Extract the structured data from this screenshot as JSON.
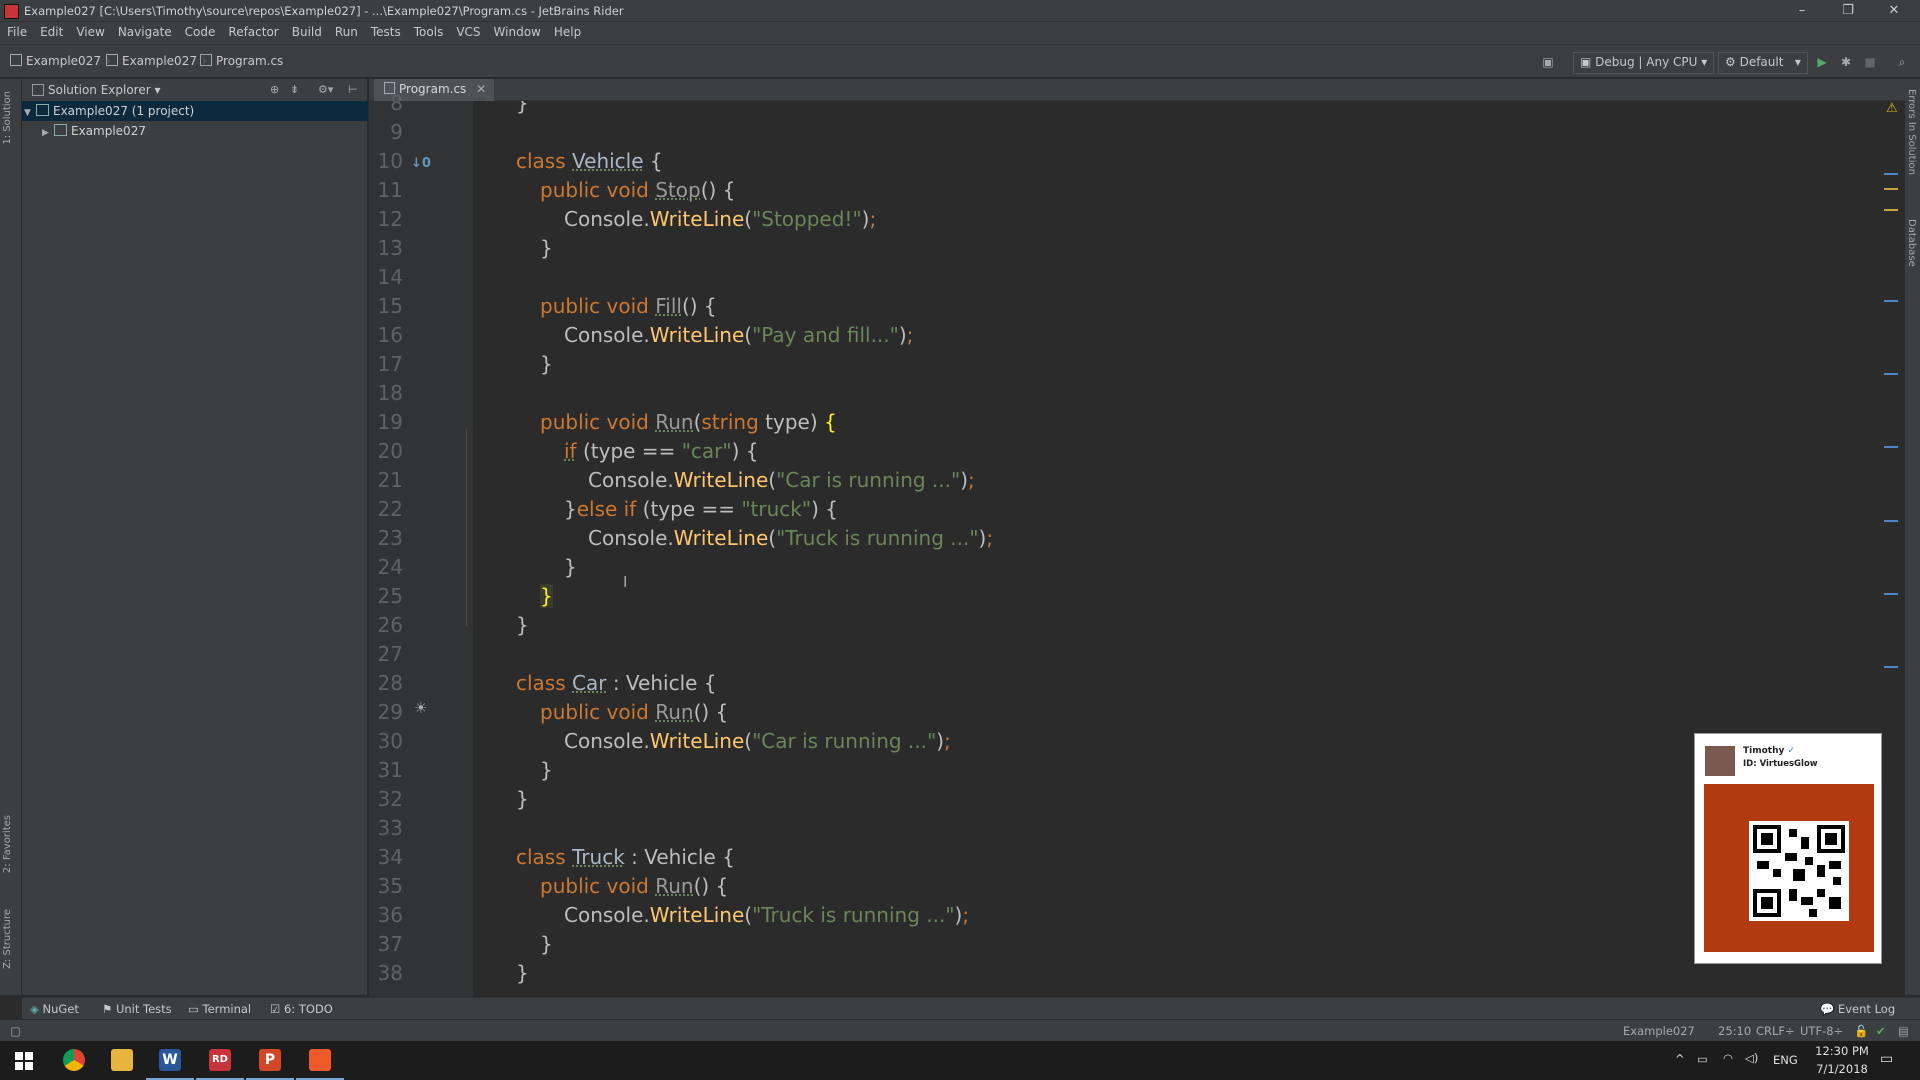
{
  "titlebar": {
    "title": "Example027 [C:\\Users\\Timothy\\source\\repos\\Example027] - ...\\Example027\\Program.cs - JetBrains Rider",
    "minimize": "–",
    "restore": "❐",
    "close": "✕"
  },
  "menu": [
    "File",
    "Edit",
    "View",
    "Navigate",
    "Code",
    "Refactor",
    "Build",
    "Run",
    "Tests",
    "Tools",
    "VCS",
    "Window",
    "Help"
  ],
  "breadcrumbs": [
    "Example027",
    "Example027",
    "Program.cs"
  ],
  "toolbar": {
    "config": "Debug | Any CPU",
    "profile": "Default"
  },
  "left_strip": {
    "solution_tab": "1: Solution",
    "favorites_tab": "2: Favorites",
    "structure_tab": "Z: Structure"
  },
  "right_strip": {
    "errors_tab": "Errors In Solution",
    "database_tab": "Database"
  },
  "solution_explorer": {
    "title": "Solution Explorer",
    "items": [
      {
        "label": "Example027 (1 project)",
        "expanded": true,
        "selected": true
      },
      {
        "label": "Example027",
        "expanded": false,
        "selected": false
      }
    ]
  },
  "editor": {
    "tab": "Program.cs",
    "override_marker": "0",
    "line_numbers": [
      "8",
      "9",
      "10",
      "11",
      "12",
      "13",
      "14",
      "15",
      "16",
      "17",
      "18",
      "19",
      "20",
      "21",
      "22",
      "23",
      "24",
      "25",
      "26",
      "27",
      "28",
      "29",
      "30",
      "31",
      "32",
      "33",
      "34",
      "35",
      "36",
      "37",
      "38"
    ]
  },
  "badge": {
    "name": "Timothy",
    "id_label": "ID: VirtuesGlow"
  },
  "bottom_tabs": [
    "NuGet",
    "Unit Tests",
    "Terminal",
    "6: TODO",
    "Event Log"
  ],
  "status": {
    "project": "Example027",
    "position": "25:10",
    "line_sep": "CRLF÷",
    "encoding": "UTF-8÷"
  },
  "taskbar": {
    "lang": "ENG",
    "time": "12:30 PM",
    "date": "7/1/2018"
  },
  "colors": {
    "keyword": "#cc7832",
    "string": "#6a8759",
    "method": "#ffc66d",
    "background": "#2b2b2b"
  }
}
